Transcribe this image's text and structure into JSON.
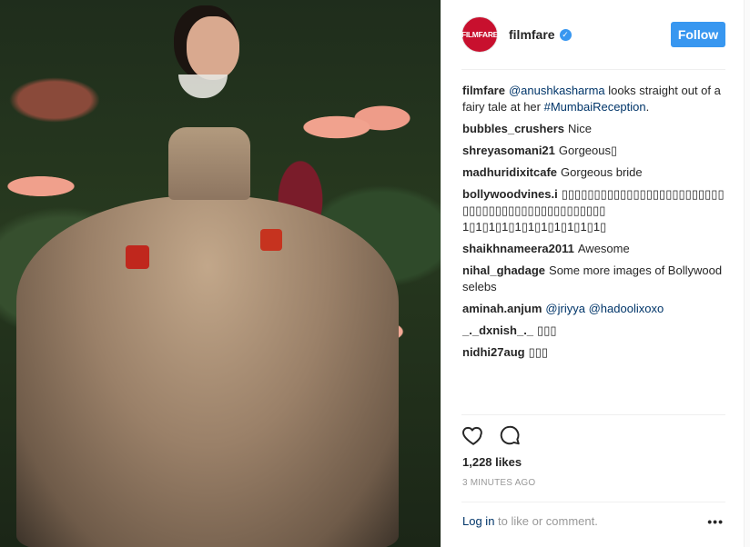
{
  "account": {
    "avatar_text": "FILMFARE",
    "username": "filmfare",
    "verified_glyph": "✓",
    "follow_label": "Follow"
  },
  "caption": {
    "user": "filmfare",
    "mention": "@anushkasharma",
    "text": " looks straight out of a fairy tale at her ",
    "hashtag": "#MumbaiReception",
    "end": "."
  },
  "comments": [
    {
      "user": "bubbles_crushers",
      "text": "Nice"
    },
    {
      "user": "shreyasomani21",
      "text": "Gorgeous▯"
    },
    {
      "user": "madhuridixitcafe",
      "text": "Gorgeous bride"
    },
    {
      "user": "bollywoodvines.i",
      "text": "▯▯▯▯▯▯▯▯▯▯▯▯▯▯▯▯▯▯▯▯▯▯▯▯▯▯▯▯▯▯▯▯▯▯▯▯▯▯▯▯▯▯▯▯▯▯▯ 1▯1▯1▯1▯1▯1▯1▯1▯1▯1▯1▯"
    },
    {
      "user": "shaikhnameera2011",
      "text": "Awesome"
    },
    {
      "user": "nihal_ghadage",
      "text": "Some more images of Bollywood selebs"
    },
    {
      "user": "aminah.anjum",
      "mention1": "@jriyya",
      "mention2": "@hadoolixoxo"
    },
    {
      "user": "_._dxnish_._",
      "text": "▯▯▯"
    },
    {
      "user": "nidhi27aug",
      "text": "▯▯▯"
    }
  ],
  "actions": {
    "like_icon": "heart-icon",
    "comment_icon": "comment-icon"
  },
  "likes": "1,228 likes",
  "timestamp": "3 MINUTES AGO",
  "login": {
    "link": "Log in",
    "text": " to like or comment."
  },
  "more_glyph": "•••",
  "colors": {
    "accent": "#3897f0",
    "link": "#003569",
    "brand": "#c8102e"
  }
}
